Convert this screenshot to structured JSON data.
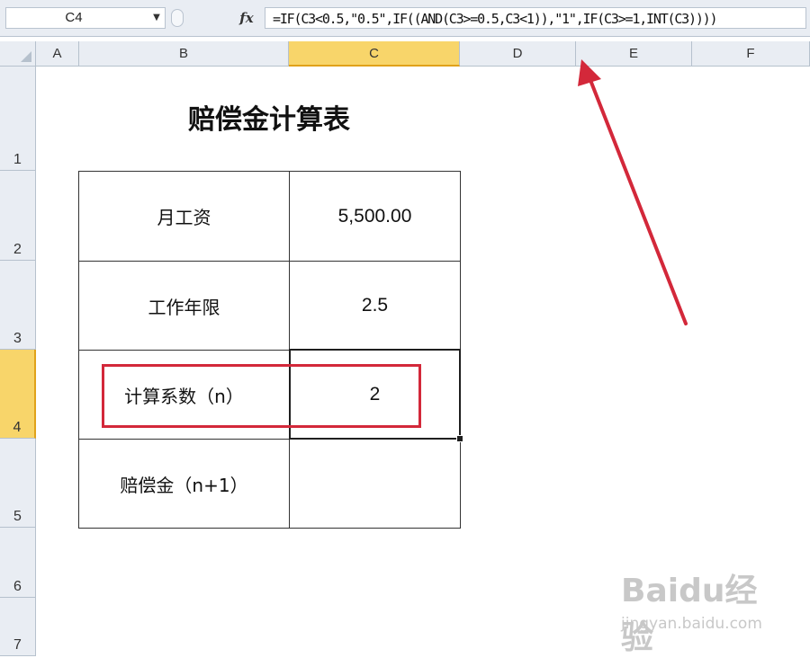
{
  "formula_bar": {
    "name_box": "C4",
    "fx_label": "fx",
    "formula": "=IF(C3<0.5,\"0.5\",IF((AND(C3>=0.5,C3<1)),\"1\",IF(C3>=1,INT(C3))))"
  },
  "columns": [
    "A",
    "B",
    "C",
    "D",
    "E",
    "F"
  ],
  "rows": [
    "1",
    "2",
    "3",
    "4",
    "5",
    "6",
    "7"
  ],
  "active_cell": "C4",
  "sheet": {
    "title": "赔偿金计算表",
    "table": [
      {
        "label": "月工资",
        "value": "5,500.00"
      },
      {
        "label": "工作年限",
        "value": "2.5"
      },
      {
        "label": "计算系数（n）",
        "value": "2"
      },
      {
        "label": "赔偿金（n+1）",
        "value": ""
      }
    ]
  },
  "annotation": {
    "color": "#d3283a"
  },
  "watermark": {
    "brand": "Baidu经验",
    "site": "jingyan.baidu.com"
  }
}
